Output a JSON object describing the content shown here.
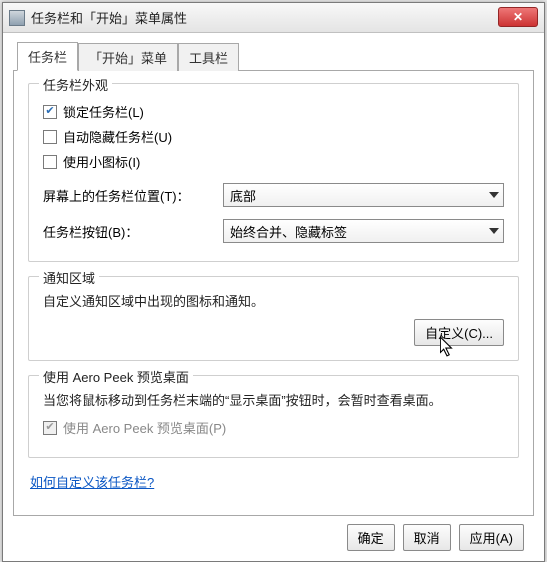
{
  "window": {
    "title": "任务栏和「开始」菜单属性",
    "close_glyph": "✕"
  },
  "tabs": {
    "taskbar": "任务栏",
    "startmenu": "「开始」菜单",
    "toolbars": "工具栏"
  },
  "appearance": {
    "title": "任务栏外观",
    "lock": "锁定任务栏(L)",
    "autohide": "自动隐藏任务栏(U)",
    "smallicons": "使用小图标(I)",
    "position_label": "屏幕上的任务栏位置(T)：",
    "position_value": "底部",
    "buttons_label": "任务栏按钮(B)：",
    "buttons_value": "始终合并、隐藏标签"
  },
  "notify": {
    "title": "通知区域",
    "desc": "自定义通知区域中出现的图标和通知。",
    "customize_btn": "自定义(C)..."
  },
  "peek": {
    "title": "使用 Aero Peek 预览桌面",
    "desc": "当您将鼠标移动到任务栏末端的“显示桌面”按钮时，会暂时查看桌面。",
    "checkbox": "使用 Aero Peek 预览桌面(P)"
  },
  "help_link": "如何自定义该任务栏?",
  "buttons": {
    "ok": "确定",
    "cancel": "取消",
    "apply": "应用(A)"
  }
}
